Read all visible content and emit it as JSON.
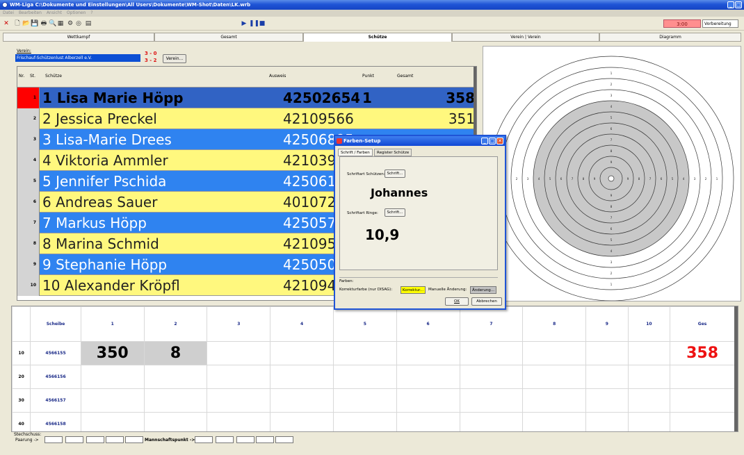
{
  "window": {
    "title": "WM-Liga C:\\Dokumente und Einstellungen\\All Users\\Dokumente\\WM-Shot\\Daten\\LK.wrb"
  },
  "menu": [
    "Datei",
    "Bearbeiten",
    "Ansicht",
    "Optionen",
    "?"
  ],
  "toolbar": {
    "timer": "3:00",
    "phase": "Vorbereitung"
  },
  "tabs": [
    "Wettkampf",
    "Gesamt",
    "Schütze",
    "Verein | Verein",
    "Diagramm"
  ],
  "club": {
    "label": "Verein:",
    "name": "Frischauf-Schützenlust Alberzell e.V.",
    "score1": "3 - 0",
    "score2": "3 - 2",
    "button": "Verein..."
  },
  "grid": {
    "headers": {
      "nr": "Nr.",
      "st": "St.",
      "shooter": "Schütze",
      "id": "Ausweis",
      "point": "Punkt",
      "total": "Gesamt"
    },
    "rows": [
      {
        "nr": "1",
        "name": "1 Lisa Marie Höpp",
        "id": "42502654",
        "point": "1",
        "total": "358"
      },
      {
        "nr": "2",
        "name": "2 Jessica Preckel",
        "id": "42109566",
        "point": "",
        "total": "351"
      },
      {
        "nr": "3",
        "name": "3 Lisa-Marie Drees",
        "id": "42506895",
        "point": "",
        "total": ""
      },
      {
        "nr": "4",
        "name": "4 Viktoria Ammler",
        "id": "42103999",
        "point": "",
        "total": ""
      },
      {
        "nr": "5",
        "name": "5 Jennifer Pschida",
        "id": "42506171",
        "point": "",
        "total": ""
      },
      {
        "nr": "6",
        "name": "6 Andreas Sauer",
        "id": "40107283",
        "point": "",
        "total": ""
      },
      {
        "nr": "7",
        "name": "7 Markus Höpp",
        "id": "4250573",
        "point": "",
        "total": ""
      },
      {
        "nr": "8",
        "name": "8 Marina Schmid",
        "id": "4210951",
        "point": "",
        "total": ""
      },
      {
        "nr": "9",
        "name": "9 Stephanie Höpp",
        "id": "4250507",
        "point": "",
        "total": ""
      },
      {
        "nr": "10",
        "name": "10 Alexander Kröpfl",
        "id": "4210948",
        "point": "",
        "total": ""
      }
    ]
  },
  "dialog": {
    "title": "Farben-Setup",
    "tab1": "Schrift / Farben",
    "tab2": "Register Schütze",
    "font_shooter_label": "Schriftart Schützen:",
    "font_button": "Schrift...",
    "sample_name": "Johannes",
    "font_rings_label": "Schriftart Ringe:",
    "sample_ring": "10,9",
    "colors_group": "Farben:",
    "corr_label": "Korrekturfarbe (nur DISAG):",
    "corr_button": "Korrektur...",
    "manual_label": "Manuelle Änderung:",
    "manual_button": "Änderung...",
    "ok": "OK",
    "cancel": "Abbrechen"
  },
  "shots": {
    "header": {
      "scheibe": "Scheibe",
      "cols": [
        "1",
        "2",
        "3",
        "4",
        "5",
        "6",
        "7",
        "8",
        "9",
        "10"
      ],
      "ges": "Ges"
    },
    "rows": [
      {
        "serie": "10",
        "scheibe": "4566155",
        "v1": "350",
        "v2": "8",
        "ges": "358"
      },
      {
        "serie": "20",
        "scheibe": "4566156",
        "v1": "",
        "v2": "",
        "ges": ""
      },
      {
        "serie": "30",
        "scheibe": "4566157",
        "v1": "",
        "v2": "",
        "ges": ""
      },
      {
        "serie": "40",
        "scheibe": "4566158",
        "v1": "",
        "v2": "",
        "ges": ""
      }
    ]
  },
  "stechschuss": {
    "label": "Stechschuss:",
    "paarung": "Paarung ->",
    "mannschaft": "Mannschaftspunkt ->"
  },
  "target": {
    "ring_labels": [
      "1",
      "2",
      "3",
      "4",
      "5",
      "6",
      "7",
      "8",
      "9"
    ]
  },
  "colors": {
    "selected_row": "#3163c4",
    "blue_row": "#2f83f0",
    "yellow_row": "#fff87e",
    "accent_red": "#e11111"
  }
}
